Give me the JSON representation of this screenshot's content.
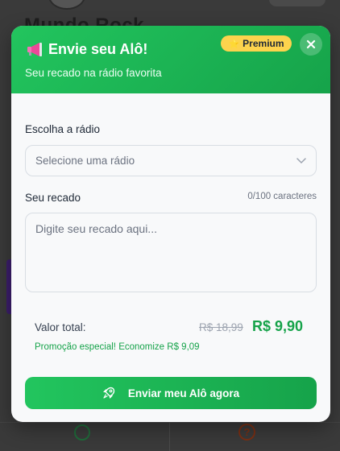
{
  "background": {
    "title": "Mundo Rock"
  },
  "modal": {
    "title": "Envie seu Alô!",
    "subtitle": "Seu recado na rádio favorita",
    "badge": "Premium",
    "close_icon": "close-icon",
    "header_icon": "megaphone-icon",
    "accent": "#22c55e",
    "accent_dark": "#16a34a",
    "badge_color": "#fcd34d"
  },
  "form": {
    "radio_label": "Escolha a rádio",
    "radio_placeholder": "Selecione uma rádio",
    "message_label": "Seu recado",
    "message_counter": "0/100 caracteres",
    "message_placeholder": "Digite seu recado aqui..."
  },
  "pricing": {
    "total_label": "Valor total:",
    "old_price": "R$ 18,99",
    "new_price": "R$ 9,90",
    "promo": "Promoção especial! Economize R$ 9,09"
  },
  "actions": {
    "submit_label": "Enviar meu Alô agora",
    "submit_icon": "rocket-icon"
  }
}
